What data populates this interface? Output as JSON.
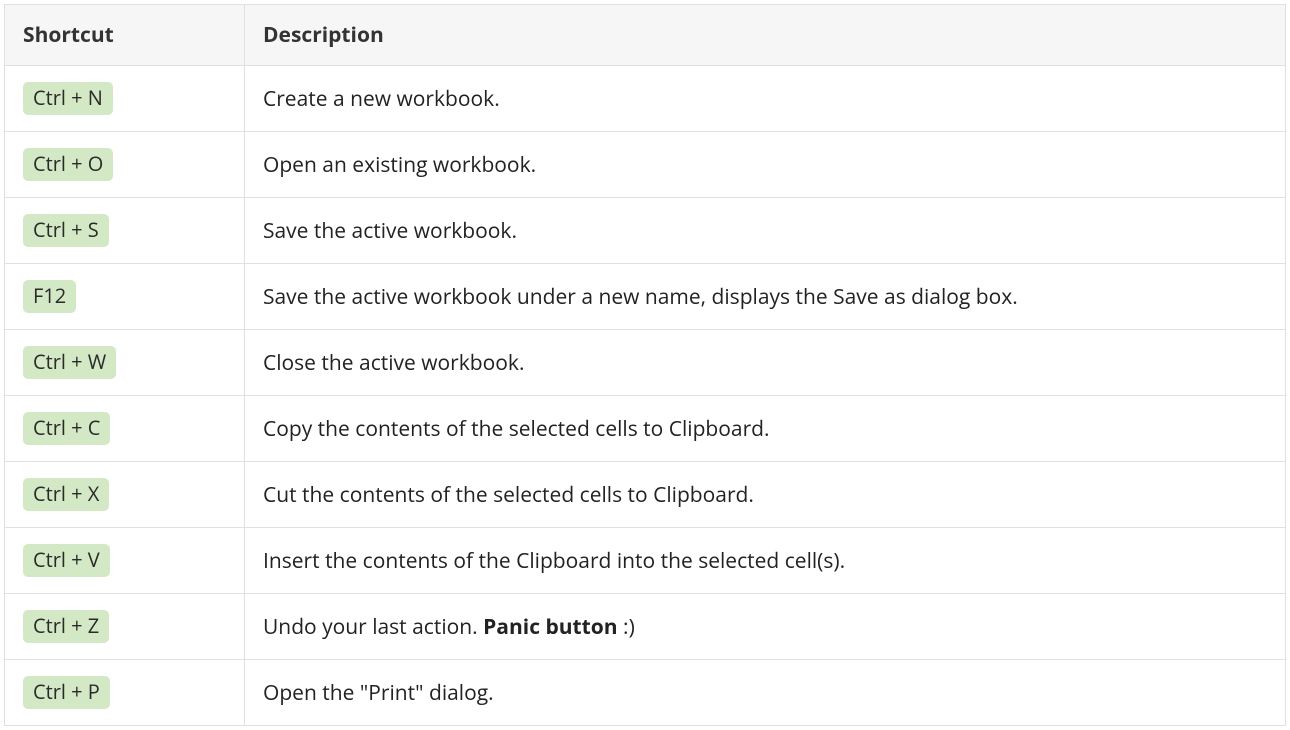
{
  "headers": {
    "shortcut": "Shortcut",
    "description": "Description"
  },
  "rows": [
    {
      "key": "Ctrl + N",
      "desc_before": "Create a new workbook.",
      "desc_bold": "",
      "desc_after": ""
    },
    {
      "key": "Ctrl + O",
      "desc_before": "Open an existing workbook.",
      "desc_bold": "",
      "desc_after": ""
    },
    {
      "key": "Ctrl + S",
      "desc_before": "Save the active workbook.",
      "desc_bold": "",
      "desc_after": ""
    },
    {
      "key": "F12",
      "desc_before": "Save the active workbook under a new name, displays the Save as dialog box.",
      "desc_bold": "",
      "desc_after": ""
    },
    {
      "key": "Ctrl + W",
      "desc_before": "Close the active workbook.",
      "desc_bold": "",
      "desc_after": ""
    },
    {
      "key": "Ctrl + C",
      "desc_before": "Copy the contents of the selected cells to Clipboard.",
      "desc_bold": "",
      "desc_after": ""
    },
    {
      "key": "Ctrl + X",
      "desc_before": "Cut the contents of the selected cells to Clipboard.",
      "desc_bold": "",
      "desc_after": ""
    },
    {
      "key": "Ctrl + V",
      "desc_before": "Insert the contents of the Clipboard into the selected cell(s).",
      "desc_bold": "",
      "desc_after": ""
    },
    {
      "key": "Ctrl + Z",
      "desc_before": "Undo your last action. ",
      "desc_bold": "Panic button",
      "desc_after": " :)"
    },
    {
      "key": "Ctrl + P",
      "desc_before": "Open the \"Print\" dialog.",
      "desc_bold": "",
      "desc_after": ""
    }
  ]
}
